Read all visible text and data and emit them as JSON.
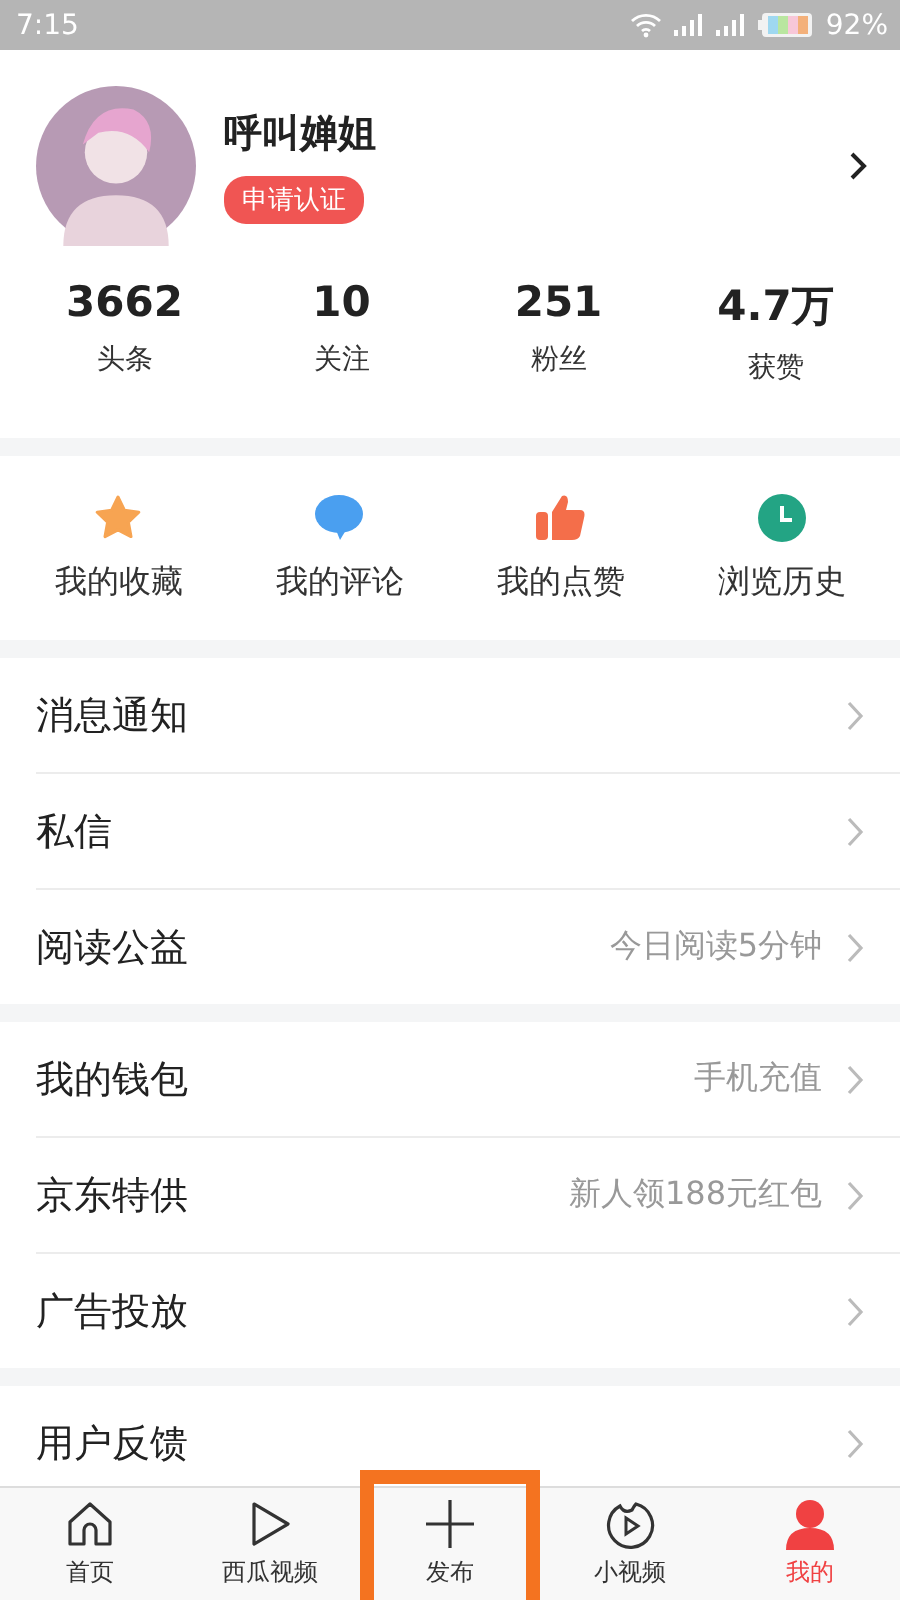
{
  "status_bar": {
    "time": "7:15",
    "battery": "92%"
  },
  "profile": {
    "name": "呼叫婵姐",
    "badge": "申请认证"
  },
  "stats": [
    {
      "value": "3662",
      "label": "头条"
    },
    {
      "value": "10",
      "label": "关注"
    },
    {
      "value": "251",
      "label": "粉丝"
    },
    {
      "value": "4.7万",
      "label": "获赞"
    }
  ],
  "shortcuts": [
    {
      "kind": "star",
      "label": "我的收藏"
    },
    {
      "kind": "comment",
      "label": "我的评论"
    },
    {
      "kind": "like",
      "label": "我的点赞"
    },
    {
      "kind": "history",
      "label": "浏览历史"
    }
  ],
  "menu_groups": [
    [
      {
        "label": "消息通知"
      },
      {
        "label": "私信"
      },
      {
        "label": "阅读公益",
        "hint": "今日阅读5分钟"
      }
    ],
    [
      {
        "label": "我的钱包",
        "hint": "手机充值"
      },
      {
        "label": "京东特供",
        "hint": "新人领188元红包"
      },
      {
        "label": "广告投放"
      }
    ],
    [
      {
        "label": "用户反馈"
      }
    ]
  ],
  "tabs": [
    {
      "kind": "home",
      "label": "首页",
      "selected": false,
      "highlighted": false
    },
    {
      "kind": "play",
      "label": "西瓜视频",
      "selected": false,
      "highlighted": false
    },
    {
      "kind": "plus",
      "label": "发布",
      "selected": false,
      "highlighted": true
    },
    {
      "kind": "video",
      "label": "小视频",
      "selected": false,
      "highlighted": false
    },
    {
      "kind": "user",
      "label": "我的",
      "selected": true,
      "highlighted": false
    }
  ]
}
